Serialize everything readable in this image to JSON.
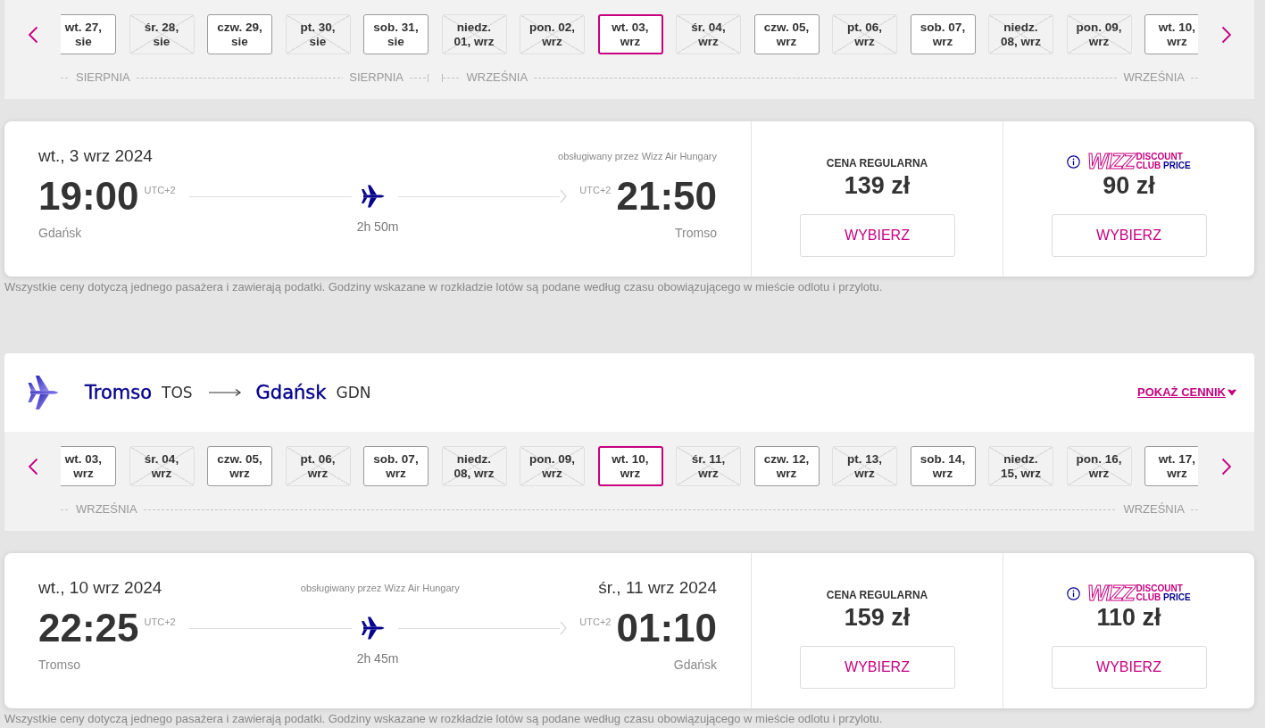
{
  "outbound": {
    "date_strip": {
      "months": [
        {
          "start_label": "SIERPNIA",
          "end_label": "SIERPNIA",
          "days": [
            {
              "lines": [
                "wt. 27,",
                "sie"
              ],
              "available": true,
              "selected": false
            },
            {
              "lines": [
                "śr. 28,",
                "sie"
              ],
              "available": false,
              "selected": false
            },
            {
              "lines": [
                "czw. 29,",
                "sie"
              ],
              "available": true,
              "selected": false
            },
            {
              "lines": [
                "pt. 30,",
                "sie"
              ],
              "available": false,
              "selected": false
            },
            {
              "lines": [
                "sob. 31,",
                "sie"
              ],
              "available": true,
              "selected": false
            }
          ]
        },
        {
          "start_label": "WRZEŚNIA",
          "end_label": "WRZEŚNIA",
          "days": [
            {
              "lines": [
                "niedz.",
                "01, wrz"
              ],
              "available": false,
              "selected": false
            },
            {
              "lines": [
                "pon. 02,",
                "wrz"
              ],
              "available": false,
              "selected": false
            },
            {
              "lines": [
                "wt. 03,",
                "wrz"
              ],
              "available": true,
              "selected": true
            },
            {
              "lines": [
                "śr. 04,",
                "wrz"
              ],
              "available": false,
              "selected": false
            },
            {
              "lines": [
                "czw. 05,",
                "wrz"
              ],
              "available": true,
              "selected": false
            },
            {
              "lines": [
                "pt. 06,",
                "wrz"
              ],
              "available": false,
              "selected": false
            },
            {
              "lines": [
                "sob. 07,",
                "wrz"
              ],
              "available": true,
              "selected": false
            },
            {
              "lines": [
                "niedz.",
                "08, wrz"
              ],
              "available": false,
              "selected": false
            },
            {
              "lines": [
                "pon. 09,",
                "wrz"
              ],
              "available": false,
              "selected": false
            },
            {
              "lines": [
                "wt. 10,",
                "wrz"
              ],
              "available": true,
              "selected": false
            }
          ]
        }
      ]
    },
    "flight": {
      "departure_date": "wt., 3 wrz 2024",
      "operator": "obsługiwany przez Wizz Air Hungary",
      "departure_time": "19:00",
      "departure_tz": "UTC+2",
      "departure_city": "Gdańsk",
      "duration": "2h 50m",
      "arrival_tz": "UTC+2",
      "arrival_time": "21:50",
      "arrival_city": "Tromso",
      "fares": [
        {
          "kind": "regular",
          "title": "CENA REGULARNA",
          "price": "139 zł",
          "button": "WYBIERZ"
        },
        {
          "kind": "club",
          "logo": {
            "mark": "WIZZ",
            "top": "DISCOUNT",
            "bottom_left": "CLUB",
            "bottom_right": "PRICE"
          },
          "price": "90 zł",
          "button": "WYBIERZ"
        }
      ]
    },
    "note": "Wszystkie ceny dotyczą jednego pasażera i zawierają podatki. Godziny wskazane w rozkładzie lotów są podane według czasu obowiązującego w mieście odlotu i przylotu."
  },
  "return": {
    "route": {
      "origin_city": "Tromso",
      "origin_code": "TOS",
      "destination_city": "Gdańsk",
      "destination_code": "GDN",
      "price_list_link": "POKAŻ CENNIK"
    },
    "date_strip": {
      "months": [
        {
          "start_label": "WRZEŚNIA",
          "end_label": "WRZEŚNIA",
          "days": [
            {
              "lines": [
                "wt. 03,",
                "wrz"
              ],
              "available": true,
              "selected": false
            },
            {
              "lines": [
                "śr. 04,",
                "wrz"
              ],
              "available": false,
              "selected": false
            },
            {
              "lines": [
                "czw. 05,",
                "wrz"
              ],
              "available": true,
              "selected": false
            },
            {
              "lines": [
                "pt. 06,",
                "wrz"
              ],
              "available": false,
              "selected": false
            },
            {
              "lines": [
                "sob. 07,",
                "wrz"
              ],
              "available": true,
              "selected": false
            },
            {
              "lines": [
                "niedz.",
                "08, wrz"
              ],
              "available": false,
              "selected": false
            },
            {
              "lines": [
                "pon. 09,",
                "wrz"
              ],
              "available": false,
              "selected": false
            },
            {
              "lines": [
                "wt. 10,",
                "wrz"
              ],
              "available": true,
              "selected": true
            },
            {
              "lines": [
                "śr. 11,",
                "wrz"
              ],
              "available": false,
              "selected": false
            },
            {
              "lines": [
                "czw. 12,",
                "wrz"
              ],
              "available": true,
              "selected": false
            },
            {
              "lines": [
                "pt. 13,",
                "wrz"
              ],
              "available": false,
              "selected": false
            },
            {
              "lines": [
                "sob. 14,",
                "wrz"
              ],
              "available": true,
              "selected": false
            },
            {
              "lines": [
                "niedz.",
                "15, wrz"
              ],
              "available": false,
              "selected": false
            },
            {
              "lines": [
                "pon. 16,",
                "wrz"
              ],
              "available": false,
              "selected": false
            },
            {
              "lines": [
                "wt. 17,",
                "wrz"
              ],
              "available": true,
              "selected": false
            }
          ]
        }
      ]
    },
    "flight": {
      "departure_date": "wt., 10 wrz 2024",
      "operator": "obsługiwany przez Wizz Air Hungary",
      "arrival_date": "śr., 11 wrz 2024",
      "departure_time": "22:25",
      "departure_tz": "UTC+2",
      "departure_city": "Tromso",
      "duration": "2h 45m",
      "arrival_tz": "UTC+2",
      "arrival_time": "01:10",
      "arrival_city": "Gdańsk",
      "fares": [
        {
          "kind": "regular",
          "title": "CENA REGULARNA",
          "price": "159 zł",
          "button": "WYBIERZ"
        },
        {
          "kind": "club",
          "logo": {
            "mark": "WIZZ",
            "top": "DISCOUNT",
            "bottom_left": "CLUB",
            "bottom_right": "PRICE"
          },
          "price": "110 zł",
          "button": "WYBIERZ"
        }
      ]
    },
    "note": "Wszystkie ceny dotyczą jednego pasażera i zawierają podatki. Godziny wskazane w rozkładzie lotów są podane według czasu obowiązującego w mieście odlotu i przylotu."
  }
}
